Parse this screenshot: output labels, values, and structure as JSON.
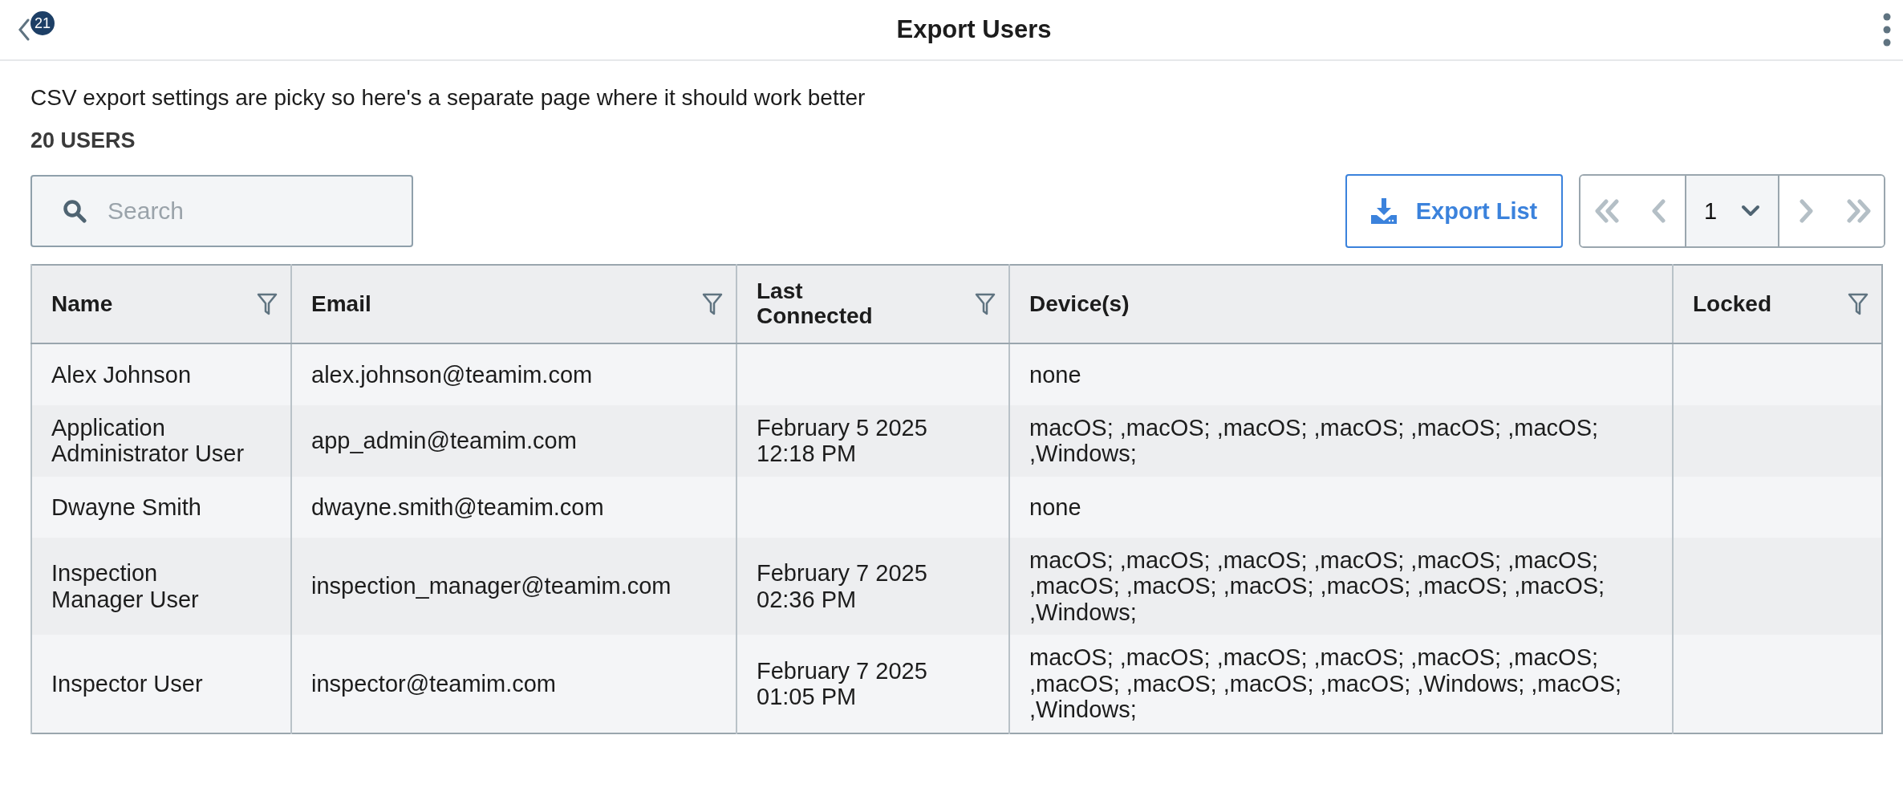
{
  "header": {
    "title": "Export Users",
    "back_badge": "21"
  },
  "description": "CSV export settings are picky so here's a separate page where it should work better",
  "count": "20 USERS",
  "search": {
    "placeholder": "Search"
  },
  "export_button": "Export List",
  "pager": {
    "page": "1"
  },
  "table": {
    "columns": [
      {
        "label": "Name",
        "filter": true
      },
      {
        "label": "Email",
        "filter": true
      },
      {
        "label": "Last Connected",
        "filter": true
      },
      {
        "label": "Device(s)",
        "filter": false
      },
      {
        "label": "Locked",
        "filter": true
      }
    ],
    "rows": [
      {
        "name": "Alex Johnson",
        "email": "alex.johnson@teamim.com",
        "last_connected": "",
        "devices": "none",
        "locked": ""
      },
      {
        "name": "Application Administrator User",
        "email": "app_admin@teamim.com",
        "last_connected": "February 5 2025 12:18 PM",
        "devices": "macOS; ,macOS; ,macOS; ,macOS; ,macOS; ,macOS; ,Windows;",
        "locked": ""
      },
      {
        "name": "Dwayne Smith",
        "email": "dwayne.smith@teamim.com",
        "last_connected": "",
        "devices": "none",
        "locked": ""
      },
      {
        "name": "Inspection Manager User",
        "email": "inspection_manager@teamim.com",
        "last_connected": "February 7 2025 02:36 PM",
        "devices": "macOS; ,macOS; ,macOS; ,macOS; ,macOS; ,macOS; ,macOS; ,macOS; ,macOS; ,macOS; ,macOS; ,macOS; ,Windows;",
        "locked": ""
      },
      {
        "name": "Inspector User",
        "email": "inspector@teamim.com",
        "last_connected": "February 7 2025 01:05 PM",
        "devices": "macOS; ,macOS; ,macOS; ,macOS; ,macOS; ,macOS; ,macOS; ,macOS; ,macOS; ,macOS; ,Windows; ,macOS; ,Windows;",
        "locked": ""
      }
    ]
  }
}
